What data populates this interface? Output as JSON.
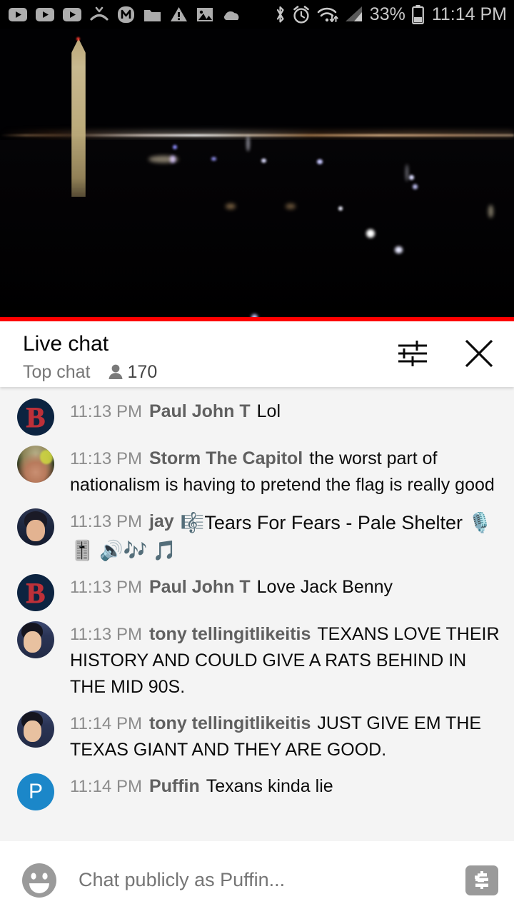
{
  "status_bar": {
    "notification_icons": [
      "youtube-icon",
      "youtube-icon",
      "youtube-icon",
      "missed-call-icon",
      "m-app-icon",
      "folder-icon",
      "warning-icon",
      "image-icon",
      "cloud-icon"
    ],
    "system_icons": [
      "bluetooth-icon",
      "alarm-icon",
      "wifi-icon",
      "signal-icon",
      "battery-icon"
    ],
    "battery_percent": "33%",
    "time": "11:14 PM"
  },
  "video": {
    "scene": "Washington Monument night live stream",
    "progress_bar_color": "#ff0000",
    "is_live": true
  },
  "chat_header": {
    "title": "Live chat",
    "mode": "Top chat",
    "viewer_icon": "person-icon",
    "viewer_count": "170",
    "settings_icon": "tune-icon",
    "close_icon": "close-icon"
  },
  "messages": [
    {
      "time": "11:13 PM",
      "author": "Paul John T",
      "text": "Lol",
      "avatar": "redsox",
      "emojis": ""
    },
    {
      "time": "11:13 PM",
      "author": "Storm The Capitol",
      "text": "the worst part of nationalism is having to pretend the flag is really good",
      "avatar": "photo1",
      "emojis": ""
    },
    {
      "time": "11:13 PM",
      "author": "jay",
      "text": "🎼Tears For Fears - Pale Shelter 🎙️ 🎚️ 🔊🎶 🎵",
      "avatar": "photo2",
      "emojis": "🎼🎙️🎚️🔊🎶🎵"
    },
    {
      "time": "11:13 PM",
      "author": "Paul John T",
      "text": "Love Jack Benny",
      "avatar": "redsox",
      "emojis": ""
    },
    {
      "time": "11:13 PM",
      "author": "tony tellingitlikeitis",
      "text": "TEXANS LOVE THEIR HISTORY AND COULD GIVE A RATS BEHIND IN THE MID 90S.",
      "avatar": "photo3",
      "emojis": ""
    },
    {
      "time": "11:14 PM",
      "author": "tony tellingitlikeitis",
      "text": "JUST GIVE EM THE TEXAS GIANT AND THEY ARE GOOD.",
      "avatar": "photo3",
      "emojis": ""
    },
    {
      "time": "11:14 PM",
      "author": "Puffin",
      "text": "Texans kinda lie",
      "avatar": "puffin",
      "emojis": ""
    }
  ],
  "input_bar": {
    "emoji_icon": "emoji-smiley-icon",
    "placeholder": "Chat publicly as Puffin...",
    "value": "",
    "superchat_icon": "dollar-sign-icon"
  },
  "colors": {
    "live_red": "#ff0000",
    "chat_bg": "#f4f4f4",
    "author_gray": "#606060",
    "timestamp_gray": "#8c8c8c",
    "puffin_blue": "#1b87c9"
  }
}
